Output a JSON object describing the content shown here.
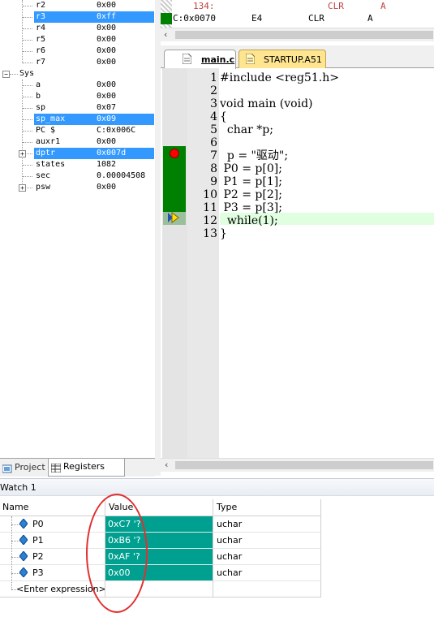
{
  "registers": {
    "rows": [
      {
        "name": "r2",
        "value": "0x00",
        "selected": false
      },
      {
        "name": "r3",
        "value": "0xff",
        "selected": true
      },
      {
        "name": "r4",
        "value": "0x00",
        "selected": false
      },
      {
        "name": "r5",
        "value": "0x00",
        "selected": false
      },
      {
        "name": "r6",
        "value": "0x00",
        "selected": false
      },
      {
        "name": "r7",
        "value": "0x00",
        "selected": false
      }
    ],
    "sys_label": "Sys",
    "sys_rows": [
      {
        "name": "a",
        "value": "0x00",
        "selected": false,
        "expand": false
      },
      {
        "name": "b",
        "value": "0x00",
        "selected": false,
        "expand": false
      },
      {
        "name": "sp",
        "value": "0x07",
        "selected": false,
        "expand": false
      },
      {
        "name": "sp_max",
        "value": "0x09",
        "selected": true,
        "expand": false
      },
      {
        "name": "PC  $",
        "value": "C:0x006C",
        "selected": false,
        "expand": false
      },
      {
        "name": "auxr1",
        "value": "0x00",
        "selected": false,
        "expand": false
      },
      {
        "name": "dptr",
        "value": "0x007d",
        "selected": true,
        "expand": true
      },
      {
        "name": "states",
        "value": "1082",
        "selected": false,
        "expand": false
      },
      {
        "name": "sec",
        "value": "0.00004508",
        "selected": false,
        "expand": false
      },
      {
        "name": "psw",
        "value": "0x00",
        "selected": false,
        "expand": true
      }
    ]
  },
  "left_tabs": {
    "project": "Project",
    "registers": "Registers"
  },
  "disasm": {
    "line1": {
      "addr": "134:",
      "op": "CLR",
      "arg": "A"
    },
    "line2": {
      "addr": "C:0x0070",
      "hex": "E4",
      "op": "CLR",
      "arg": "A"
    }
  },
  "editor": {
    "tabs": [
      {
        "label": "main.c",
        "active": true
      },
      {
        "label": "STARTUP.A51",
        "active": false
      }
    ],
    "lines": [
      {
        "n": "1",
        "code": "#include <reg51.h>"
      },
      {
        "n": "2",
        "code": ""
      },
      {
        "n": "3",
        "code": "void main (void)"
      },
      {
        "n": "4",
        "code": "{"
      },
      {
        "n": "5",
        "code": "  char *p;"
      },
      {
        "n": "6",
        "code": ""
      },
      {
        "n": "7",
        "code": "  p = \"驱动\";"
      },
      {
        "n": "8",
        "code": " P0 = p[0];"
      },
      {
        "n": "9",
        "code": " P1 = p[1];"
      },
      {
        "n": "10",
        "code": " P2 = p[2];"
      },
      {
        "n": "11",
        "code": " P3 = p[3];"
      },
      {
        "n": "12",
        "code": "  while(1);"
      },
      {
        "n": "13",
        "code": "}"
      }
    ]
  },
  "watch": {
    "title": "Watch 1",
    "headers": {
      "name": "Name",
      "value": "Value",
      "type": "Type"
    },
    "rows": [
      {
        "name": "P0",
        "value": "0xC7 '?",
        "type": "uchar"
      },
      {
        "name": "P1",
        "value": "0xB6 '?",
        "type": "uchar"
      },
      {
        "name": "P2",
        "value": "0xAF '?",
        "type": "uchar"
      },
      {
        "name": "P3",
        "value": "0x00",
        "type": "uchar"
      }
    ],
    "enter_expression": "<Enter expression>"
  },
  "colors": {
    "selection": "#3399ff",
    "watch_value_bg": "#00a090",
    "coverage_green": "#008000",
    "breakpoint_red": "#ff0000",
    "current_line_bg": "#e0ffe0",
    "annotation_circle": "#e03030"
  }
}
